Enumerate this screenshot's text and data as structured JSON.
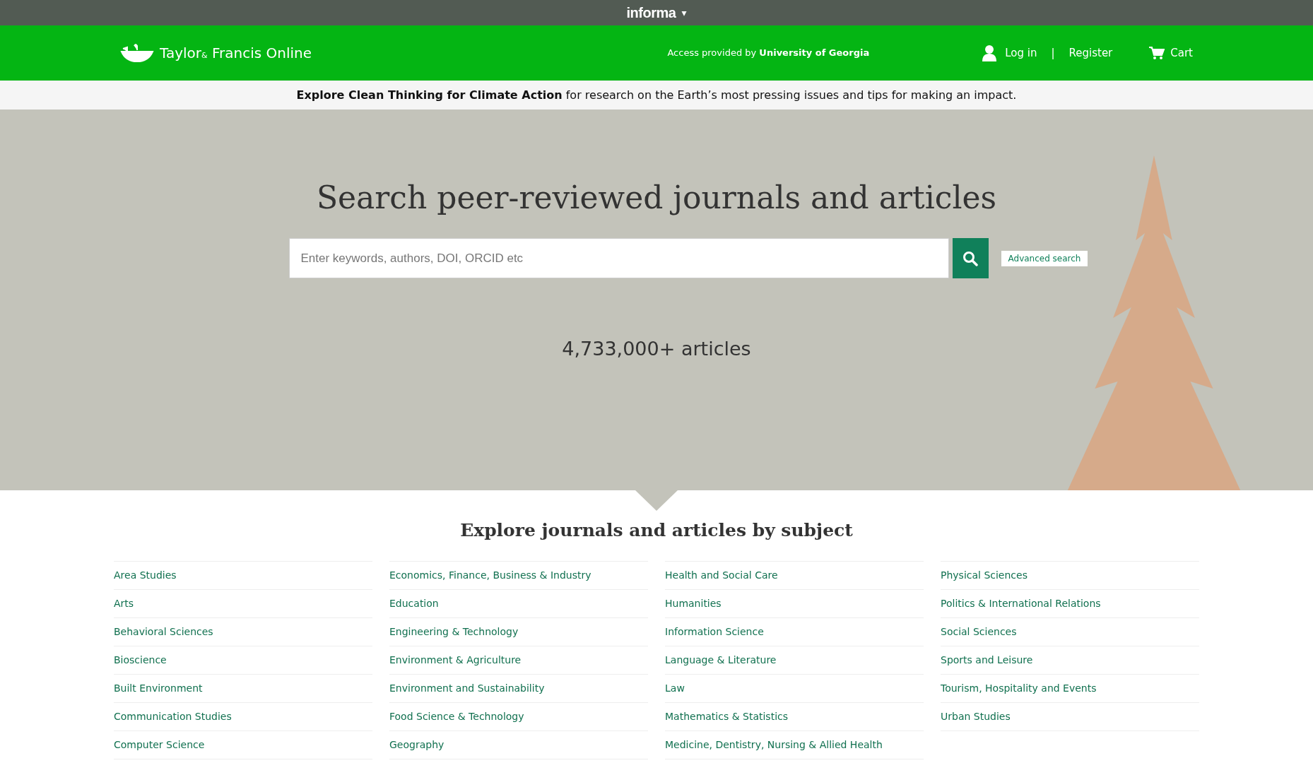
{
  "top_bar": {
    "brand": "informa",
    "caret": "▾"
  },
  "header": {
    "logo_text": "Taylor",
    "logo_amp": "&",
    "logo_text2": "Francis Online",
    "access_label": "Access provided by",
    "access_org": "University of Georgia",
    "login": "Log in",
    "separator": "|",
    "register": "Register",
    "cart": "Cart"
  },
  "banner": {
    "text": "**Explore Clean Thinking for Climate Action** for research on the Earth’s most pressing issues and tips for making an impact."
  },
  "hero": {
    "title": "Search peer-reviewed journals and articles",
    "search": {
      "placeholder": "Enter keywords, authors, DOI, ORCID etc"
    },
    "advanced_search": "Advanced search",
    "count": "4,733,000+ articles"
  },
  "subjects": {
    "title": "Explore journals and articles by subject",
    "columns": [
      [
        "Area Studies",
        "Arts",
        "Behavioral Sciences",
        "Bioscience",
        "Built Environment",
        "Communication Studies",
        "Computer Science"
      ],
      [
        "Economics, Finance, Business & Industry",
        "Education",
        "Engineering & Technology",
        "Environment & Agriculture",
        "Environment and Sustainability",
        "Food Science & Technology",
        "Geography"
      ],
      [
        "Health and Social Care",
        "Humanities",
        "Information Science",
        "Language & Literature",
        "Law",
        "Mathematics & Statistics",
        "Medicine, Dentistry, Nursing & Allied Health"
      ],
      [
        "Physical Sciences",
        "Politics & International Relations",
        "Social Sciences",
        "Sports and Leisure",
        "Tourism, Hospitality and Events",
        "Urban Studies"
      ]
    ]
  }
}
